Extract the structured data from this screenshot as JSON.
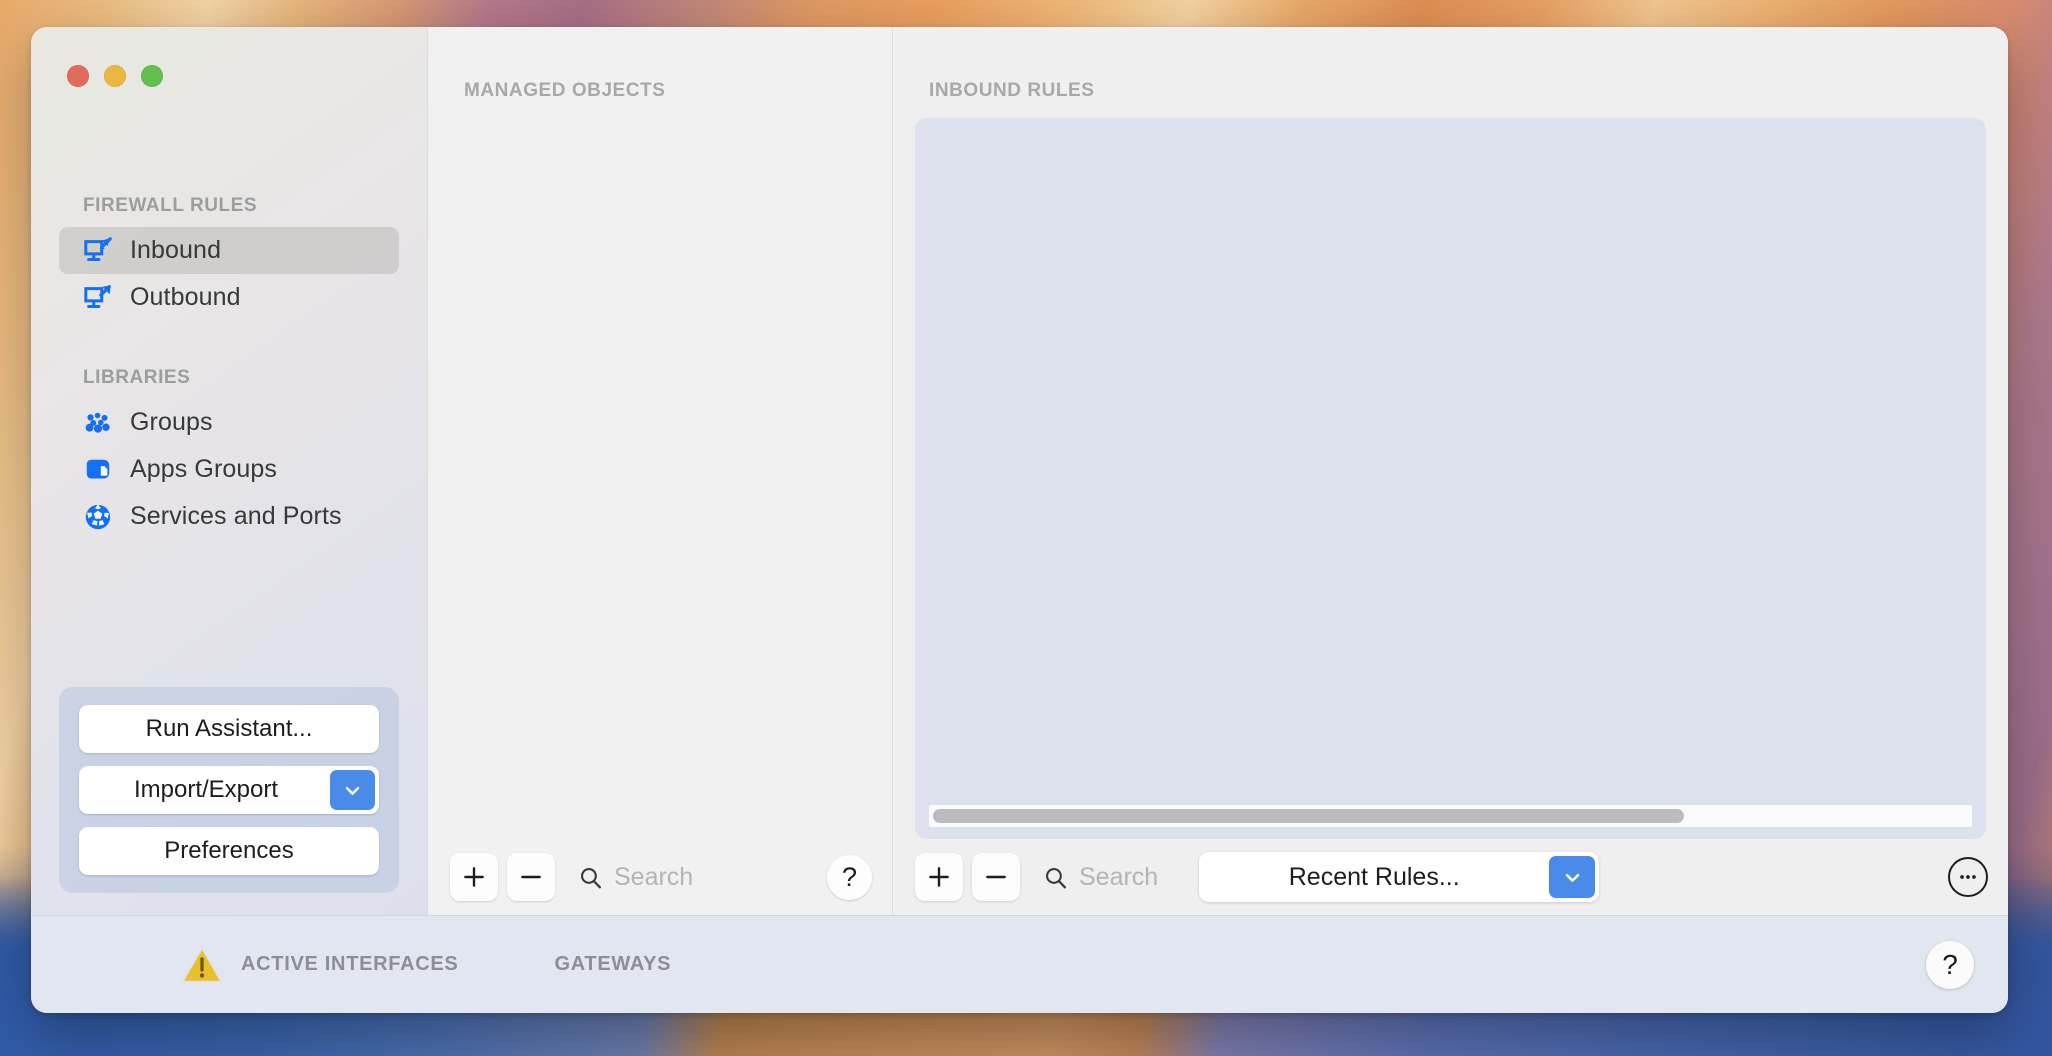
{
  "window": {
    "traffic_lights": [
      "close",
      "minimize",
      "zoom"
    ]
  },
  "sidebar": {
    "sections": [
      {
        "title": "FIREWALL RULES",
        "items": [
          {
            "label": "Inbound",
            "icon": "display-inbound-icon",
            "selected": true
          },
          {
            "label": "Outbound",
            "icon": "display-outbound-icon",
            "selected": false
          }
        ]
      },
      {
        "title": "LIBRARIES",
        "items": [
          {
            "label": "Groups",
            "icon": "groups-icon",
            "selected": false
          },
          {
            "label": "Apps Groups",
            "icon": "apps-groups-icon",
            "selected": false
          },
          {
            "label": "Services and Ports",
            "icon": "services-ports-icon",
            "selected": false
          }
        ]
      }
    ],
    "actions": {
      "run_assistant": "Run Assistant...",
      "import_export": "Import/Export",
      "preferences": "Preferences"
    }
  },
  "managed_objects": {
    "header": "MANAGED OBJECTS",
    "toolbar": {
      "add": "+",
      "remove": "−",
      "search_placeholder": "Search",
      "help": "?"
    }
  },
  "inbound_rules": {
    "header": "INBOUND RULES",
    "toolbar": {
      "add": "+",
      "remove": "−",
      "search_placeholder": "Search",
      "recent_rules": "Recent Rules...",
      "more": "more-options"
    },
    "scroll": {
      "thumb_percent": 72
    }
  },
  "statusbar": {
    "tabs": [
      {
        "label": "ACTIVE INTERFACES",
        "icon": "warning-triangle-icon"
      },
      {
        "label": "GATEWAYS",
        "icon": ""
      }
    ],
    "help": "?"
  },
  "colors": {
    "accent_blue": "#4a8ae8",
    "icon_blue": "#1570ef",
    "warning_yellow": "#e8c02e",
    "selected_row": "#b8b6b0",
    "rules_pane": "#dde1ed",
    "statusbar": "#e2e6f0"
  }
}
